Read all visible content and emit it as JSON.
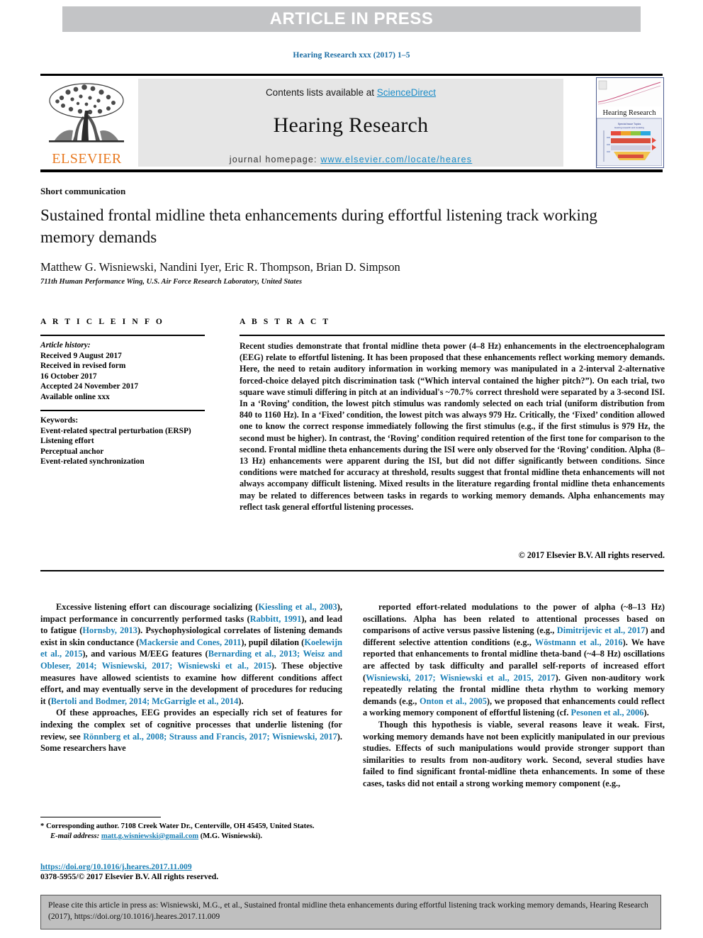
{
  "banner": {
    "text": "ARTICLE IN PRESS"
  },
  "running_head": "Hearing Research xxx (2017) 1–5",
  "masthead": {
    "contents_prefix": "Contents lists available at ",
    "sciencedirect": "ScienceDirect",
    "journal_title": "Hearing Research",
    "homepage_prefix": "journal homepage: ",
    "homepage_url": "www.elsevier.com/locate/heares",
    "publisher": "ELSEVIER",
    "cover_title": "Hearing Research"
  },
  "article": {
    "section_label": "Short communication",
    "title": "Sustained frontal midline theta enhancements during effortful listening track working memory demands",
    "authors_html": "Matthew G. Wisniewski, Nandini Iyer, Eric R. Thompson, Brian D. Simpson",
    "affiliation": "711th Human Performance Wing, U.S. Air Force Research Laboratory, United States"
  },
  "info": {
    "heading": "A R T I C L E  I N F O",
    "history_label": "Article history:",
    "history": [
      "Received 9 August 2017",
      "Received in revised form",
      "16 October 2017",
      "Accepted 24 November 2017",
      "Available online xxx"
    ],
    "keywords_label": "Keywords:",
    "keywords": [
      "Event-related spectral perturbation (ERSP)",
      "Listening effort",
      "Perceptual anchor",
      "Event-related synchronization"
    ]
  },
  "abstract": {
    "heading": "A B S T R A C T",
    "text": "Recent studies demonstrate that frontal midline theta power (4–8 Hz) enhancements in the electroencephalogram (EEG) relate to effortful listening. It has been proposed that these enhancements reflect working memory demands. Here, the need to retain auditory information in working memory was manipulated in a 2-interval 2-alternative forced-choice delayed pitch discrimination task (“Which interval contained the higher pitch?”). On each trial, two square wave stimuli differing in pitch at an individual's ~70.7% correct threshold were separated by a 3-second ISI. In a ‘Roving’ condition, the lowest pitch stimulus was randomly selected on each trial (uniform distribution from 840 to 1160 Hz). In a ‘Fixed’ condition, the lowest pitch was always 979 Hz. Critically, the ‘Fixed’ condition allowed one to know the correct response immediately following the first stimulus (e.g., if the first stimulus is 979 Hz, the second must be higher). In contrast, the ‘Roving’ condition required retention of the first tone for comparison to the second. Frontal midline theta enhancements during the ISI were only observed for the ‘Roving’ condition. Alpha (8–13 Hz) enhancements were apparent during the ISI, but did not differ significantly between conditions. Since conditions were matched for accuracy at threshold, results suggest that frontal midline theta enhancements will not always accompany difficult listening. Mixed results in the literature regarding frontal midline theta enhancements may be related to differences between tasks in regards to working memory demands. Alpha enhancements may reflect task general effortful listening processes.",
    "copyright": "© 2017 Elsevier B.V. All rights reserved."
  },
  "body": {
    "left_paragraphs": [
      "Excessive listening effort can discourage socializing (Kiessling et al., 2003), impact performance in concurrently performed tasks (Rabbitt, 1991), and lead to fatigue (Hornsby, 2013). Psychophysiological correlates of listening demands exist in skin conductance (Mackersie and Cones, 2011), pupil dilation (Koelewijn et al., 2015), and various M/EEG features (Bernarding et al., 2013; Weisz and Obleser, 2014; Wisniewski, 2017; Wisniewski et al., 2015). These objective measures have allowed scientists to examine how different conditions affect effort, and may eventually serve in the development of procedures for reducing it (Bertoli and Bodmer, 2014; McGarrigle et al., 2014).",
      "Of these approaches, EEG provides an especially rich set of features for indexing the complex set of cognitive processes that underlie listening (for review, see Rönnberg et al., 2008; Strauss and Francis, 2017; Wisniewski, 2017). Some researchers have"
    ],
    "right_paragraphs": [
      "reported effort-related modulations to the power of alpha (~8–13 Hz) oscillations. Alpha has been related to attentional processes based on comparisons of active versus passive listening (e.g., Dimitrijevic et al., 2017) and different selective attention conditions (e.g., Wöstmann et al., 2016). We have reported that enhancements to frontal midline theta-band (~4–8 Hz) oscillations are affected by task difficulty and parallel self-reports of increased effort (Wisniewski, 2017; Wisniewski et al., 2015, 2017). Given non-auditory work repeatedly relating the frontal midline theta rhythm to working memory demands (e.g., Onton et al., 2005), we proposed that enhancements could reflect a working memory component of effortful listening (cf. Pesonen et al., 2006).",
      "Though this hypothesis is viable, several reasons leave it weak. First, working memory demands have not been explicitly manipulated in our previous studies. Effects of such manipulations would provide stronger support than similarities to results from non-auditory work. Second, several studies have failed to find significant frontal-midline theta enhancements. In some of these cases, tasks did not entail a strong working memory component (e.g.,"
    ]
  },
  "footnote": {
    "corresponding": "* Corresponding author. 7108 Creek Water Dr., Centerville, OH 45459, United States.",
    "email_label": "E-mail address:",
    "email": "matt.g.wisniewski@gmail.com",
    "email_owner": "(M.G. Wisniewski).",
    "doi": "https://doi.org/10.1016/j.heares.2017.11.009",
    "issn_line": "0378-5955/© 2017 Elsevier B.V. All rights reserved."
  },
  "cite_box": {
    "text": "Please cite this article in press as: Wisniewski, M.G., et al., Sustained frontal midline theta enhancements during effortful listening track working memory demands, Hearing Research (2017), https://doi.org/10.1016/j.heares.2017.11.009"
  },
  "colors": {
    "link": "#1a8cc8",
    "ref": "#1a7fb5",
    "banner_bg": "#c3c4c6",
    "masthead_bg": "#e6e6e6",
    "elsevier_orange": "#e87a22",
    "cite_bg": "#bfbfbf"
  }
}
